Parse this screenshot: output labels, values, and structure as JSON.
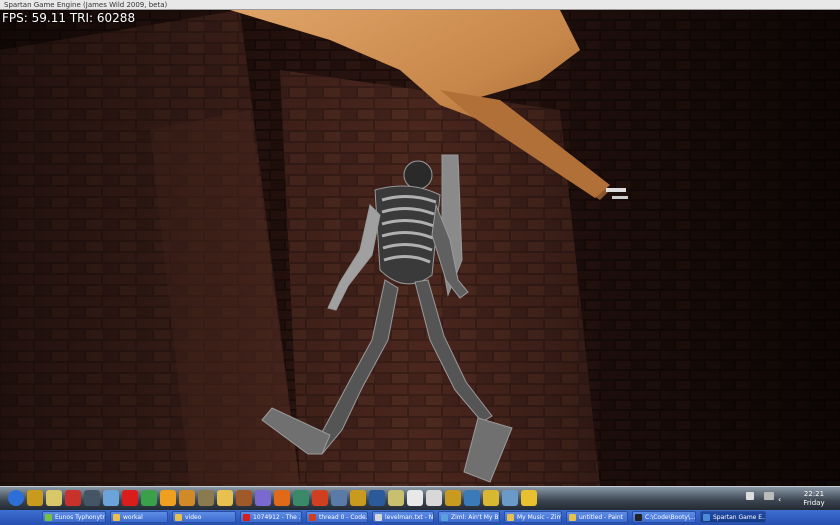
{
  "window": {
    "title": "Spartan Game Engine (James Wild 2009, beta)"
  },
  "hud": {
    "fps_label": "FPS:",
    "fps_value": "59.11",
    "tri_label": "TRI:",
    "tri_value": "60288"
  },
  "dock": {
    "icons": [
      {
        "name": "dock-app-orb-icon",
        "color": "#2d6fd6"
      },
      {
        "name": "dock-app-u-icon",
        "color": "#c89a1d"
      },
      {
        "name": "dock-app-compass-icon",
        "color": "#d9c86a"
      },
      {
        "name": "dock-app-red-icon",
        "color": "#c8322a"
      },
      {
        "name": "dock-app-media-icon",
        "color": "#445566"
      },
      {
        "name": "dock-app-computer-icon",
        "color": "#6ca3d8"
      },
      {
        "name": "dock-app-opera-icon",
        "color": "#d91d1d"
      },
      {
        "name": "dock-app-security-icon",
        "color": "#3aa04a"
      },
      {
        "name": "dock-app-windows-icon",
        "color": "#f0a020"
      },
      {
        "name": "dock-app-diamond-icon",
        "color": "#d08a28"
      },
      {
        "name": "dock-app-gimp-icon",
        "color": "#8a7a50"
      },
      {
        "name": "dock-app-folder-icon",
        "color": "#e8c050"
      },
      {
        "name": "dock-app-pen-icon",
        "color": "#a05a2a"
      },
      {
        "name": "dock-app-globe-icon",
        "color": "#7a6ad0"
      },
      {
        "name": "dock-app-firefox-icon",
        "color": "#e06a1a"
      },
      {
        "name": "dock-app-calculator-icon",
        "color": "#3a8a6a"
      },
      {
        "name": "dock-app-bomb-icon",
        "color": "#d04020"
      },
      {
        "name": "dock-app-wave-icon",
        "color": "#5a7aa8"
      },
      {
        "name": "dock-app-u2-icon",
        "color": "#c89a1d"
      },
      {
        "name": "dock-app-play-icon",
        "color": "#2a5a9a"
      },
      {
        "name": "dock-app-eye-icon",
        "color": "#c8c070"
      },
      {
        "name": "dock-app-doc-icon",
        "color": "#e8e8e8"
      },
      {
        "name": "dock-app-doc2-icon",
        "color": "#d8d8d8"
      },
      {
        "name": "dock-app-u3-icon",
        "color": "#c89a1d"
      },
      {
        "name": "dock-app-steam-icon",
        "color": "#3a7ab8"
      },
      {
        "name": "dock-app-tape-icon",
        "color": "#d8b830"
      },
      {
        "name": "dock-app-box-icon",
        "color": "#6a9ac8"
      },
      {
        "name": "dock-app-music-icon",
        "color": "#e8c030"
      }
    ]
  },
  "clock": {
    "time": "22:21",
    "day": "Friday"
  },
  "taskbar": {
    "tasks": [
      {
        "label": "Eunos Typhonytr...",
        "color": "#7ac040"
      },
      {
        "label": "workal",
        "color": "#e8c050"
      },
      {
        "label": "video",
        "color": "#e8c050"
      },
      {
        "label": "1074912 - The ...",
        "color": "#d91d1d"
      },
      {
        "label": "thread 0 - Code...",
        "color": "#d04020"
      },
      {
        "label": "levelman.txt - N...",
        "color": "#d8d8d8"
      },
      {
        "label": "Ziml: Ain't My Bit...",
        "color": "#5aa0e0"
      },
      {
        "label": "My Music - Ziml",
        "color": "#e8c050"
      },
      {
        "label": "untitled - Paint",
        "color": "#e8c050"
      },
      {
        "label": "C:\\Code\\Booty\\...",
        "color": "#222222"
      },
      {
        "label": "Spartan Game E...",
        "color": "#4a8ad8"
      }
    ]
  },
  "scene": {
    "sky": "#d9752c",
    "brick": "#3a1e18",
    "mortar": "#1a0b08",
    "wood": "#c8874a",
    "bone": "#a8a8a8"
  }
}
